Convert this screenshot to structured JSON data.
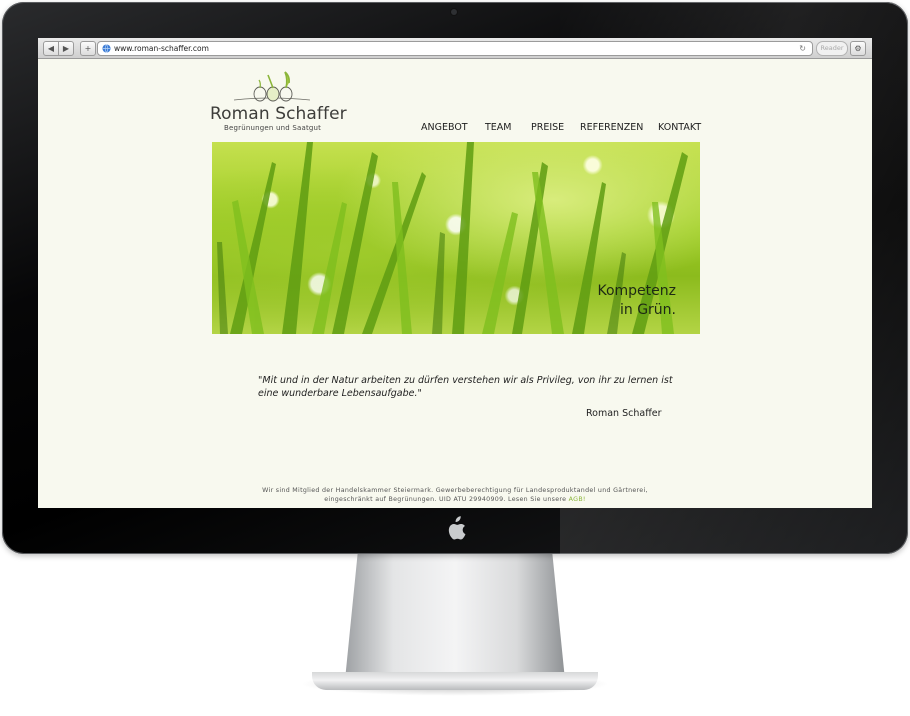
{
  "browser": {
    "url": "www.roman-schaffer.com",
    "reader_label": "Reader",
    "back_label": "◀",
    "forward_label": "▶",
    "add_label": "+",
    "reload_label": "↻",
    "settings_label": "⚙"
  },
  "site": {
    "logo_name": "Roman Schaffer",
    "logo_sub": "Begrünungen und Saatgut",
    "nav": [
      "ANGEBOT",
      "TEAM",
      "PREISE",
      "REFERENZEN",
      "KONTAKT"
    ],
    "hero_slogan_line1": "Kompetenz",
    "hero_slogan_line2": "in Grün.",
    "quote": "\"Mit und in der Natur arbeiten zu dürfen verstehen wir als Privileg, von ihr zu lernen ist eine wunderbare Lebensaufgabe.\"",
    "quote_author": "Roman Schaffer",
    "footer_line1": "Wir sind Mitglied der Handelskammer Steiermark. Gewerbeberechtigung für Landesproduktandel und Gärtnerei,",
    "footer_line2_prefix": "eingeschränkt auf Begrünungen. UID ATU 29940909. Lesen Sie unsere",
    "footer_link": "AGB!"
  },
  "colors": {
    "page_background": "#f8f9ef",
    "brand_green": "#8bb53a",
    "text": "#1f1f1f"
  },
  "icons": {
    "camera": "camera-dot-icon",
    "apple": "apple-logo-icon",
    "globe": "globe-icon"
  }
}
